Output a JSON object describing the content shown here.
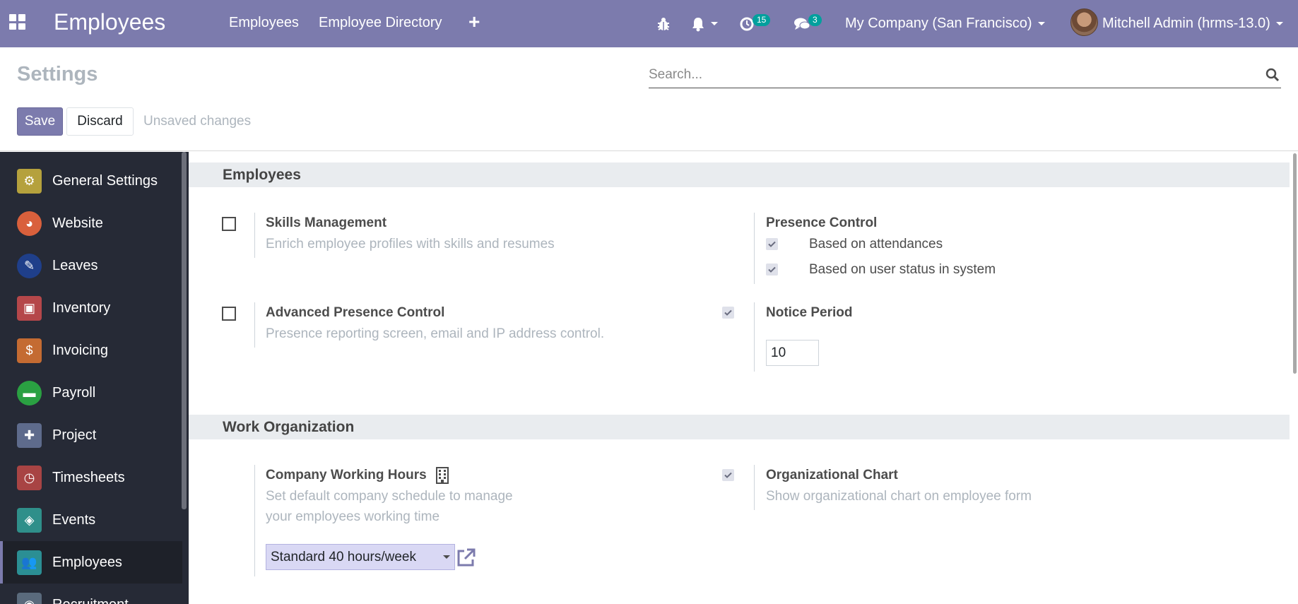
{
  "topbar": {
    "app_title": "Employees",
    "menu": [
      "Employees",
      "Employee Directory"
    ],
    "activity_count": "15",
    "message_count": "3",
    "company": "My Company (San Francisco)",
    "user": "Mitchell Admin (hrms-13.0)",
    "color": "#7c7bad"
  },
  "control": {
    "title": "Settings",
    "search_placeholder": "Search...",
    "save_label": "Save",
    "discard_label": "Discard",
    "unsaved_label": "Unsaved changes"
  },
  "sidebar": {
    "items": [
      {
        "label": "General Settings",
        "icon": "gear-icon",
        "color": "#b5a13d"
      },
      {
        "label": "Website",
        "icon": "globe-icon",
        "color": "#d9603c"
      },
      {
        "label": "Leaves",
        "icon": "edit-icon",
        "color": "#1f3f8a"
      },
      {
        "label": "Inventory",
        "icon": "box-icon",
        "color": "#b5474a"
      },
      {
        "label": "Invoicing",
        "icon": "invoice-icon",
        "color": "#c46b32"
      },
      {
        "label": "Payroll",
        "icon": "money-icon",
        "color": "#2aa042"
      },
      {
        "label": "Project",
        "icon": "puzzle-icon",
        "color": "#5e6b8c"
      },
      {
        "label": "Timesheets",
        "icon": "stopwatch-icon",
        "color": "#a84444"
      },
      {
        "label": "Events",
        "icon": "ticket-icon",
        "color": "#2f8f8a"
      },
      {
        "label": "Employees",
        "icon": "users-icon",
        "color": "#2b8f94"
      },
      {
        "label": "Recruitment",
        "icon": "recruit-icon",
        "color": "#5a6a7c"
      }
    ],
    "active": "Employees"
  },
  "main": {
    "section_employees": "Employees",
    "skills_title": "Skills Management",
    "skills_desc": "Enrich employee profiles with skills and resumes",
    "skills_checked": false,
    "presence_title": "Presence Control",
    "presence_opt1": "Based on attendances",
    "presence_opt2": "Based on user status in system",
    "adv_presence_title": "Advanced Presence Control",
    "adv_presence_desc": "Presence reporting screen, email and IP address control.",
    "adv_presence_checked": false,
    "notice_title": "Notice Period",
    "notice_value": "10",
    "section_work": "Work Organization",
    "working_hours_title": "Company Working Hours",
    "working_hours_desc1": "Set default company schedule to manage",
    "working_hours_desc2": "your employees working time",
    "working_hours_value": "Standard 40 hours/week",
    "org_chart_title": "Organizational Chart",
    "org_chart_desc": "Show organizational chart on employee form"
  }
}
